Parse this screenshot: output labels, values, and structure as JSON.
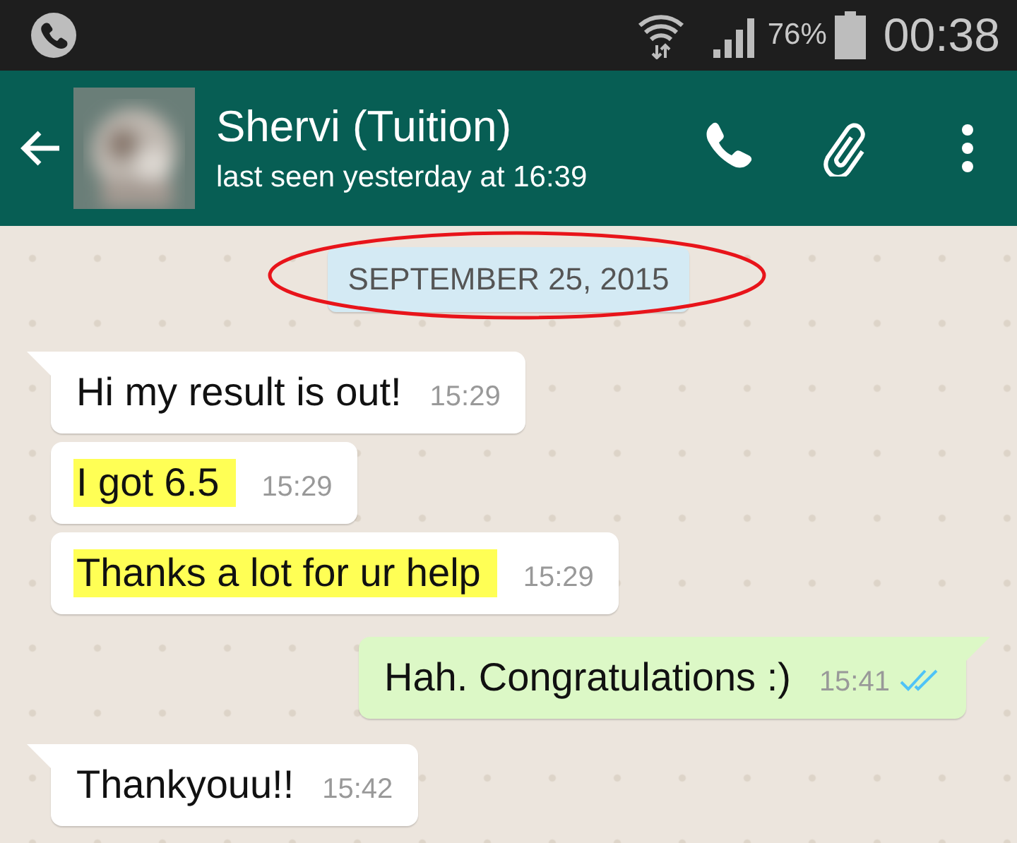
{
  "status_bar": {
    "battery": "76%",
    "time": "00:38"
  },
  "header": {
    "contact": "Shervi (Tuition)",
    "last_seen": "last seen yesterday at 16:39"
  },
  "date_chip": {
    "label": "SEPTEMBER 25, 2015",
    "circled": true
  },
  "messages": [
    {
      "outgoing": false,
      "tail": true,
      "text": "Hi my result is out!",
      "time": "15:29",
      "highlighted": false
    },
    {
      "outgoing": false,
      "tail": false,
      "text": "I got 6.5",
      "time": "15:29",
      "highlighted": true
    },
    {
      "outgoing": false,
      "tail": false,
      "text": "Thanks a lot for ur help",
      "time": "15:29",
      "highlighted": true
    },
    {
      "outgoing": true,
      "tail": true,
      "text": "Hah. Congratulations :)",
      "time": "15:41",
      "highlighted": false,
      "read": true
    },
    {
      "outgoing": false,
      "tail": true,
      "text": "Thankyouu!!",
      "time": "15:42",
      "highlighted": false
    }
  ]
}
